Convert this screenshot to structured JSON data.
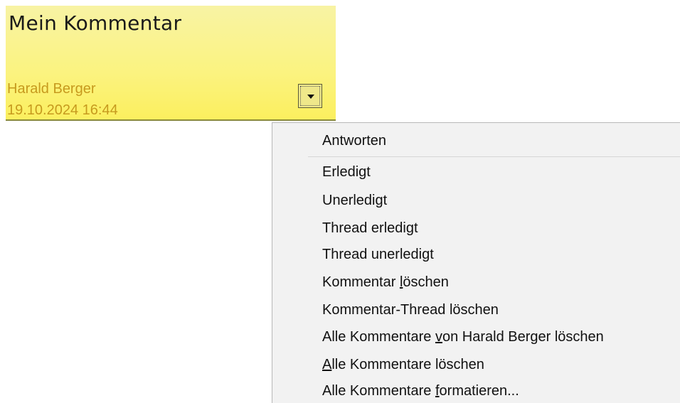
{
  "comment": {
    "text": "Mein Kommentar",
    "author": "Harald Berger",
    "date": "19.10.2024 16:44",
    "menu_button_icon": "chevron-down-icon",
    "background_color": "#fbf37f",
    "meta_color": "#c79a1e"
  },
  "menu": {
    "reply": "Antworten",
    "resolve": "Erledigt",
    "unresolve": "Unerledigt",
    "resolve_thread": "Thread erledigt",
    "unresolve_thread": "Thread unerledigt",
    "delete_comment_pre": "Kommentar ",
    "delete_comment_key": "l",
    "delete_comment_post": "öschen",
    "delete_thread": "Kommentar-Thread löschen",
    "delete_by_author_pre": "Alle Kommentare ",
    "delete_by_author_key": "v",
    "delete_by_author_post": "on Harald Berger löschen",
    "delete_all_key": "A",
    "delete_all_post": "lle Kommentare löschen",
    "format_all_pre": "Alle Kommentare ",
    "format_all_key": "f",
    "format_all_post": "ormatieren..."
  }
}
